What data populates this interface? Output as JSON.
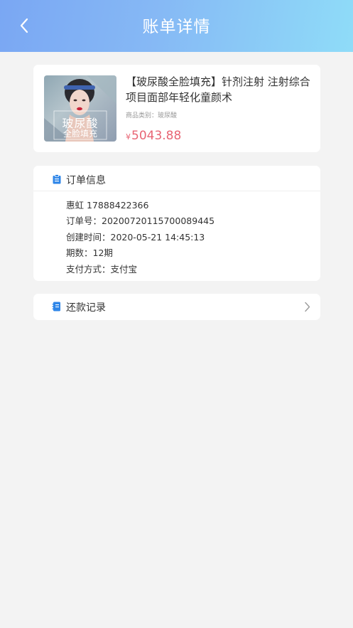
{
  "header": {
    "title": "账单详情",
    "background_colors": [
      "#7aa7f3",
      "#8fdcf8"
    ]
  },
  "product": {
    "title": "【玻尿酸全脸填充】针剂注射 注射综合项目面部年轻化童颜术",
    "category": "商品类别：玻尿酸",
    "currency": "¥",
    "price": "5043.88",
    "image_text_1": "玻尿酸",
    "image_text_2": "全脸填充",
    "price_color": "#e86574"
  },
  "order_info": {
    "title": "订单信息",
    "icon": "clipboard-icon",
    "rows": [
      "惠虹 17888422366",
      "订单号：20200720115700089445",
      "创建时间：2020-05-21 14:45:13",
      "期数：12期",
      "支付方式：支付宝"
    ]
  },
  "repayment": {
    "title": "还款记录",
    "icon": "record-icon"
  }
}
